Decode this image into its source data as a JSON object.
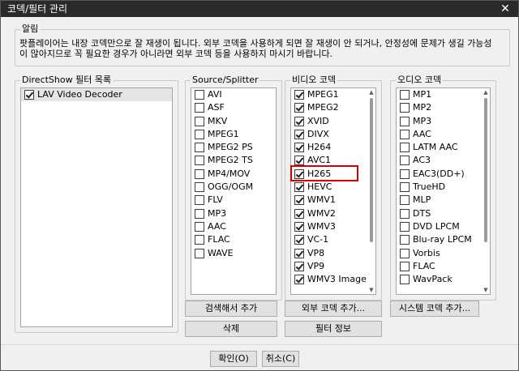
{
  "window": {
    "title": "코덱/필터 관리",
    "close_glyph": "✕"
  },
  "notice": {
    "label": "알림",
    "text": "팟플레이어는 내장 코덱만으로 잘 재생이 됩니다. 외부 코덱을 사용하게 되면 잘 재생이 안 되거나, 안정성에 문제가 생길 가능성\n이 많아지므로 꼭 필요한 경우가 아니라면 외부 코덱 등을 사용하지 마시기 바랍니다."
  },
  "directshow": {
    "label": "DirectShow 필터 목록",
    "items": [
      {
        "label": "LAV Video Decoder",
        "checked": true
      }
    ]
  },
  "source": {
    "label": "Source/Splitter",
    "items": [
      {
        "label": "AVI",
        "checked": false
      },
      {
        "label": "ASF",
        "checked": false
      },
      {
        "label": "MKV",
        "checked": false
      },
      {
        "label": "MPEG1",
        "checked": false
      },
      {
        "label": "MPEG2 PS",
        "checked": false
      },
      {
        "label": "MPEG2 TS",
        "checked": false
      },
      {
        "label": "MP4/MOV",
        "checked": false
      },
      {
        "label": "OGG/OGM",
        "checked": false
      },
      {
        "label": "FLV",
        "checked": false
      },
      {
        "label": "MP3",
        "checked": false
      },
      {
        "label": "AAC",
        "checked": false
      },
      {
        "label": "FLAC",
        "checked": false
      },
      {
        "label": "WAVE",
        "checked": false
      }
    ]
  },
  "video": {
    "label": "비디오 코덱",
    "items": [
      {
        "label": "MPEG1",
        "checked": true
      },
      {
        "label": "MPEG2",
        "checked": true
      },
      {
        "label": "XVID",
        "checked": true
      },
      {
        "label": "DIVX",
        "checked": true
      },
      {
        "label": "H264",
        "checked": true
      },
      {
        "label": "AVC1",
        "checked": true
      },
      {
        "label": "H265",
        "checked": true
      },
      {
        "label": "HEVC",
        "checked": true
      },
      {
        "label": "WMV1",
        "checked": true
      },
      {
        "label": "WMV2",
        "checked": true
      },
      {
        "label": "WMV3",
        "checked": true
      },
      {
        "label": "VC-1",
        "checked": true
      },
      {
        "label": "VP8",
        "checked": true
      },
      {
        "label": "VP9",
        "checked": true
      },
      {
        "label": "WMV3 Image",
        "checked": true
      }
    ]
  },
  "audio": {
    "label": "오디오 코덱",
    "items": [
      {
        "label": "MP1",
        "checked": false
      },
      {
        "label": "MP2",
        "checked": false
      },
      {
        "label": "MP3",
        "checked": false
      },
      {
        "label": "AAC",
        "checked": false
      },
      {
        "label": "LATM AAC",
        "checked": false
      },
      {
        "label": "AC3",
        "checked": false
      },
      {
        "label": "EAC3(DD+)",
        "checked": false
      },
      {
        "label": "TrueHD",
        "checked": false
      },
      {
        "label": "MLP",
        "checked": false
      },
      {
        "label": "DTS",
        "checked": false
      },
      {
        "label": "DVD LPCM",
        "checked": false
      },
      {
        "label": "Blu-ray LPCM",
        "checked": false
      },
      {
        "label": "Vorbis",
        "checked": false
      },
      {
        "label": "FLAC",
        "checked": false
      },
      {
        "label": "WavPack",
        "checked": false
      }
    ]
  },
  "buttons": {
    "search_add": "검색해서 추가",
    "delete": "삭제",
    "external_codec_add": "외부 코덱 추가...",
    "filter_info": "필터 정보",
    "system_codec_add": "시스템 코덱 추가...",
    "ok": "확인(O)",
    "cancel": "취소(C)"
  }
}
